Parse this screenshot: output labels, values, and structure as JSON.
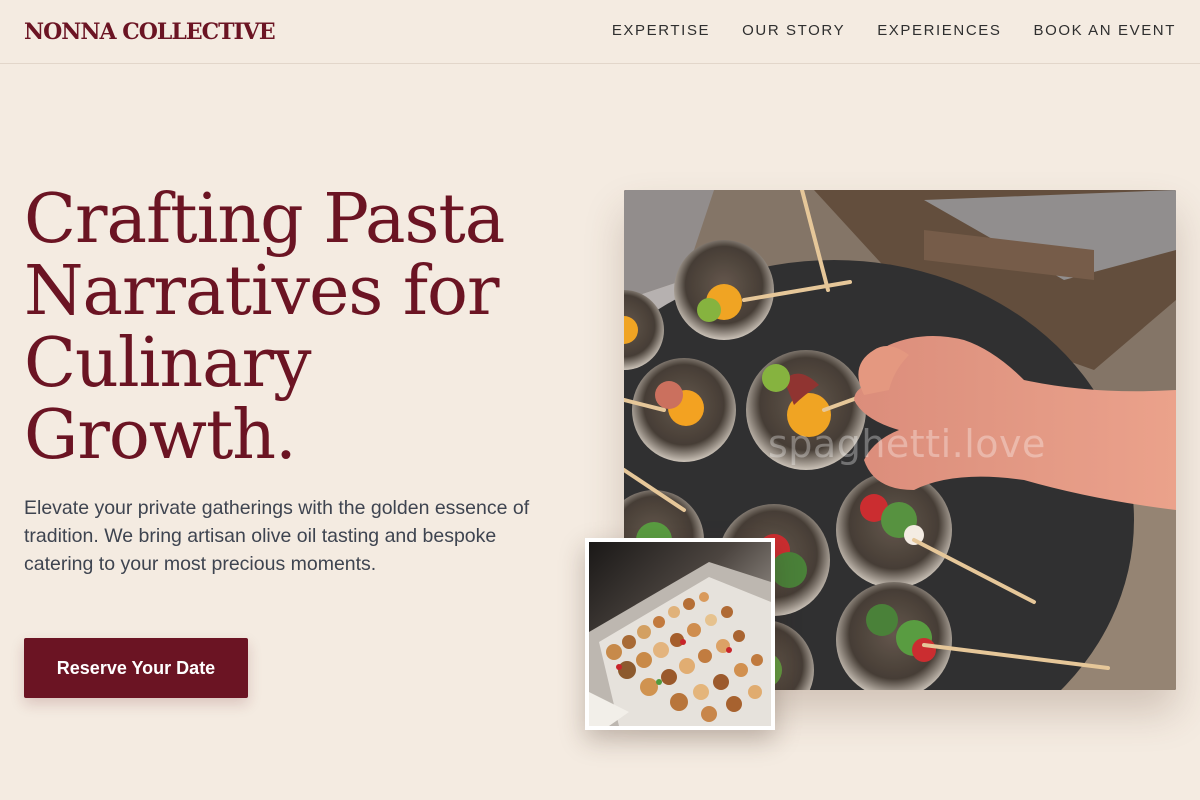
{
  "brand": {
    "name": "NONNA COLLECTIVE"
  },
  "nav": {
    "items": [
      {
        "label": "EXPERTISE"
      },
      {
        "label": "OUR STORY"
      },
      {
        "label": "EXPERIENCES"
      },
      {
        "label": "BOOK AN EVENT"
      }
    ]
  },
  "hero": {
    "title_lines": [
      "Crafting Pasta",
      "Narratives for",
      "Culinary",
      "Growth."
    ],
    "subtitle": "Elevate your private gatherings with the golden essence of tradition. We bring artisan olive oil tasting and bespoke catering to your most precious moments.",
    "cta_label": "Reserve Your Date"
  },
  "gallery": {
    "main_image_watermark": "spaghetti.love"
  },
  "colors": {
    "background": "#f4ebe1",
    "brand": "#6b1423",
    "text": "#3e4450"
  }
}
